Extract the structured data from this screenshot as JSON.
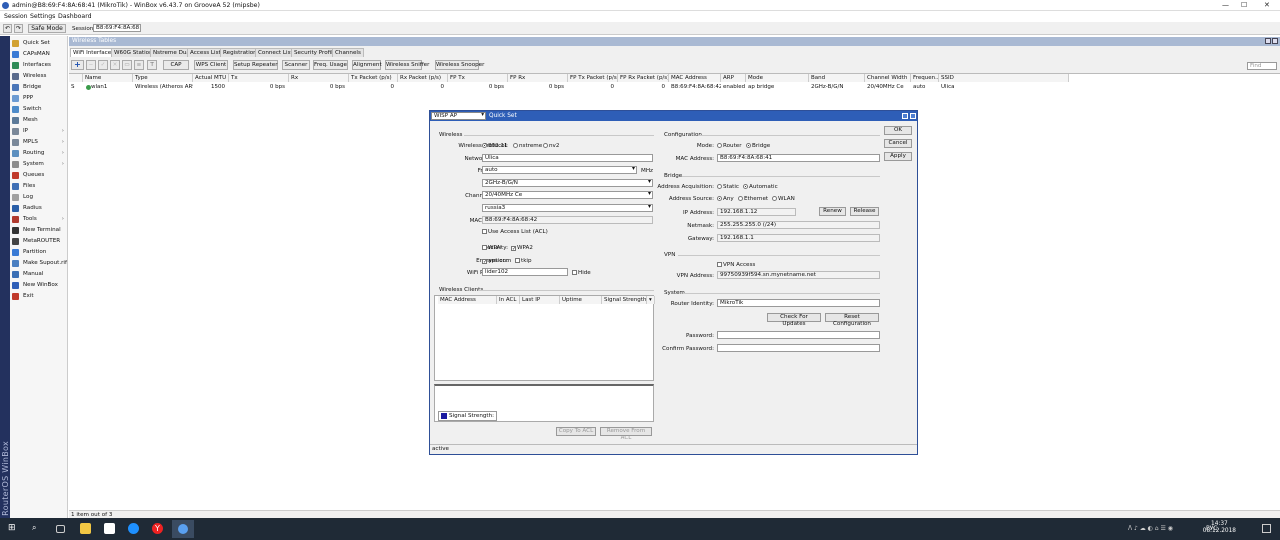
{
  "window": {
    "title": "admin@B8:69:F4:8A:68:41 (MikroTik) - WinBox v6.43.7 on GrooveA 52 (mipsbe)",
    "minimize": "—",
    "maximize": "☐",
    "close": "✕"
  },
  "menu": {
    "session": "Session",
    "settings": "Settings",
    "dashboard": "Dashboard"
  },
  "toolbar": {
    "back": "↶",
    "forward": "↷",
    "safe_mode": "Safe Mode",
    "session_label": "Session:",
    "session_value": "B8:69:F4:8A:68:41"
  },
  "sidebar": {
    "brand": "RouterOS WinBox",
    "items": [
      {
        "label": "Quick Set",
        "color": "#d2a232",
        "arrow": ""
      },
      {
        "label": "CAPsMAN",
        "color": "#3a7bd5",
        "arrow": ""
      },
      {
        "label": "Interfaces",
        "color": "#2e8b57",
        "arrow": ""
      },
      {
        "label": "Wireless",
        "color": "#5a6b8c",
        "arrow": ""
      },
      {
        "label": "Bridge",
        "color": "#4a76b8",
        "arrow": ""
      },
      {
        "label": "PPP",
        "color": "#6c9bd2",
        "arrow": ""
      },
      {
        "label": "Switch",
        "color": "#4d8bc9",
        "arrow": ""
      },
      {
        "label": "Mesh",
        "color": "#5b7a99",
        "arrow": ""
      },
      {
        "label": "IP",
        "color": "#7a8899",
        "arrow": "›"
      },
      {
        "label": "MPLS",
        "color": "#7a8899",
        "arrow": "›"
      },
      {
        "label": "Routing",
        "color": "#5c8fbf",
        "arrow": "›"
      },
      {
        "label": "System",
        "color": "#8c8c8c",
        "arrow": "›"
      },
      {
        "label": "Queues",
        "color": "#c0392b",
        "arrow": ""
      },
      {
        "label": "Files",
        "color": "#3f6fb5",
        "arrow": ""
      },
      {
        "label": "Log",
        "color": "#a0a0a0",
        "arrow": ""
      },
      {
        "label": "Radius",
        "color": "#2a5fa8",
        "arrow": ""
      },
      {
        "label": "Tools",
        "color": "#b03a2e",
        "arrow": "›"
      },
      {
        "label": "New Terminal",
        "color": "#333333",
        "arrow": ""
      },
      {
        "label": "MetaROUTER",
        "color": "#444444",
        "arrow": ""
      },
      {
        "label": "Partition",
        "color": "#3a7bd5",
        "arrow": ""
      },
      {
        "label": "Make Supout.rif",
        "color": "#4a7fc1",
        "arrow": ""
      },
      {
        "label": "Manual",
        "color": "#3a6fb5",
        "arrow": ""
      },
      {
        "label": "New WinBox",
        "color": "#2e5eb7",
        "arrow": ""
      },
      {
        "label": "Exit",
        "color": "#c0392b",
        "arrow": ""
      }
    ]
  },
  "wireless_tables": {
    "title": "Wireless Tables",
    "tabs": [
      "WiFi Interfaces",
      "W60G Station",
      "Nstreme Dual",
      "Access List",
      "Registration",
      "Connect List",
      "Security Profiles",
      "Channels"
    ],
    "buttons": [
      "CAP",
      "WPS Client",
      "Setup Repeater",
      "Scanner",
      "Freq. Usage",
      "Alignment",
      "Wireless Sniffer",
      "Wireless Snooper"
    ],
    "find_placeholder": "Find",
    "columns": [
      "Name",
      "Type",
      "Actual MTU",
      "Tx",
      "Rx",
      "Tx Packet (p/s)",
      "Rx Packet (p/s)",
      "FP Tx",
      "FP Rx",
      "FP Tx Packet (p/s)",
      "FP Rx Packet (p/s)",
      "MAC Address",
      "ARP",
      "Mode",
      "Band",
      "Channel Width",
      "Frequen...",
      "SSID"
    ],
    "row": {
      "flag": "S",
      "name": "wlan1",
      "type": "Wireless (Atheros AR9...",
      "mtu": "1500",
      "tx": "0 bps",
      "rx": "0 bps",
      "txp": "0",
      "rxp": "0",
      "fptx": "0 bps",
      "fprx": "0 bps",
      "fptxp": "0",
      "fprxp": "0",
      "mac": "B8:69:F4:8A:68:42",
      "arp": "enabled",
      "mode": "ap bridge",
      "band": "2GHz-B/G/N",
      "width": "20/40MHz Ce",
      "freq": "auto",
      "ssid": "Ulica"
    },
    "status": "1 item out of 3"
  },
  "quickset": {
    "mode": "WISP AP",
    "title": "Quick Set",
    "wireless": {
      "heading": "Wireless",
      "protocol_label": "Wireless Protocol:",
      "protocols": [
        "802.11",
        "nstreme",
        "nv2"
      ],
      "network_name_label": "Network Name:",
      "network_name": "Ulica",
      "frequency_label": "Frequency:",
      "frequency": "auto",
      "mhz": "MHz",
      "band_label": "Band:",
      "band": "2GHz-B/G/N",
      "width_label": "Channel Width:",
      "width": "20/40MHz Ce",
      "country_label": "Country:",
      "country": "russia3",
      "mac_label": "MAC Address:",
      "mac": "B8:69:F4:8A:68:42",
      "acl": "Use Access List (ACL)",
      "security_label": "Security:",
      "wpa": "WPA",
      "wpa2": "WPA2",
      "encryption_label": "Encryption:",
      "aes": "aes ccm",
      "tkip": "tkip",
      "password_label": "WiFi Password:",
      "password": "lider102",
      "hide": "Hide"
    },
    "clients": {
      "heading": "Wireless Clients",
      "columns": [
        "MAC Address",
        "In ACL",
        "Last IP",
        "Uptime",
        "Signal Strength"
      ],
      "legend": "Signal Strength:",
      "copy": "Copy To ACL",
      "remove": "Remove From ACL"
    },
    "configuration": {
      "heading": "Configuration",
      "mode_label": "Mode:",
      "router": "Router",
      "bridge": "Bridge",
      "mac_label": "MAC Address:",
      "mac": "B8:69:F4:8A:68:41"
    },
    "bridge": {
      "heading": "Bridge",
      "acq_label": "Address Acquisition:",
      "static": "Static",
      "automatic": "Automatic",
      "source_label": "Address Source:",
      "any": "Any",
      "ethernet": "Ethernet",
      "wlan": "WLAN",
      "ip_label": "IP Address:",
      "ip": "192.168.1.12",
      "renew": "Renew",
      "release": "Release",
      "netmask_label": "Netmask:",
      "netmask": "255.255.255.0 (/24)",
      "gateway_label": "Gateway:",
      "gateway": "192.168.1.1"
    },
    "vpn": {
      "heading": "VPN",
      "access": "VPN Access",
      "address_label": "VPN Address:",
      "address": "99750939f594.sn.mynetname.net"
    },
    "system": {
      "heading": "System",
      "identity_label": "Router Identity:",
      "identity": "MikroTik",
      "check": "Check For Updates",
      "reset": "Reset Configuration",
      "password_label": "Password:",
      "confirm_label": "Confirm Password:"
    },
    "ok": "OK",
    "cancel": "Cancel",
    "apply": "Apply",
    "status": "active"
  },
  "taskbar": {
    "time": "14:37",
    "date": "08.12.2018",
    "lang": "РУС"
  }
}
